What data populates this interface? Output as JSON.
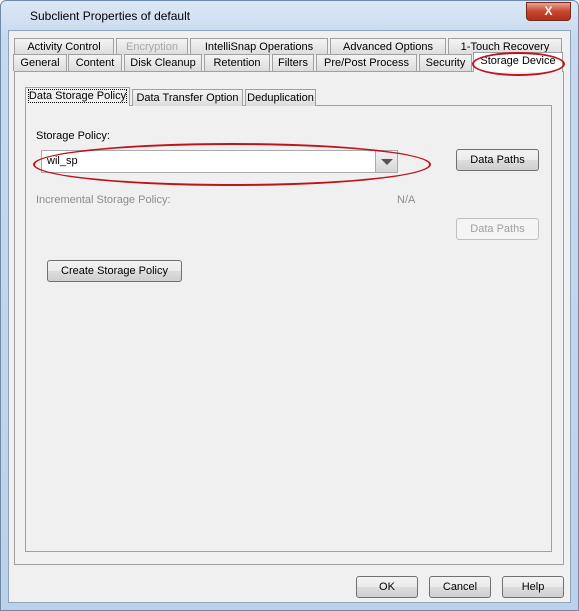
{
  "window": {
    "title": "Subclient Properties of default",
    "close_label": "X"
  },
  "tabs_row1": [
    "Activity Control",
    "Encryption",
    "IntelliSnap Operations",
    "Advanced Options",
    "1-Touch Recovery"
  ],
  "tabs_row2": [
    "General",
    "Content",
    "Disk Cleanup",
    "Retention",
    "Filters",
    "Pre/Post Process",
    "Security",
    "Storage Device"
  ],
  "active_tab": "Storage Device",
  "subtabs": [
    "Data Storage Policy",
    "Data Transfer Option",
    "Deduplication"
  ],
  "storage": {
    "policy_label": "Storage Policy:",
    "policy_value": "wil_sp",
    "data_paths": "Data Paths",
    "incremental_label": "Incremental Storage Policy:",
    "incremental_value": "N/A",
    "data_paths_disabled": "Data Paths",
    "create": "Create Storage Policy"
  },
  "footer": {
    "ok": "OK",
    "cancel": "Cancel",
    "help": "Help"
  },
  "colors": {
    "highlight": "#c0141c"
  }
}
